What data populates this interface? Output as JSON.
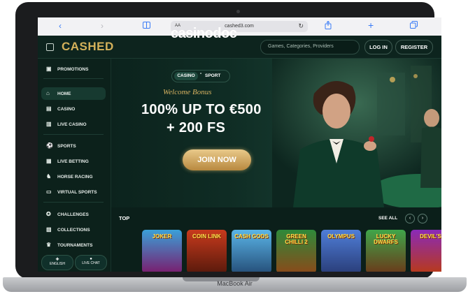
{
  "device": {
    "model": "MacBook Air"
  },
  "browser": {
    "text_size_label": "AA",
    "url": "cashed3.com",
    "back_icon": "chevron-left",
    "forward_icon": "chevron-right",
    "book_icon": "book",
    "share_icon": "share",
    "new_tab_icon": "plus",
    "tabs_icon": "tabs"
  },
  "watermark": {
    "text_pre": "casinod",
    "text_o": "o",
    "text_post": "c"
  },
  "header": {
    "logo": "CASHED",
    "search_placeholder": "Games, Categories, Providers",
    "login_label": "LOG IN",
    "register_label": "REGISTER"
  },
  "sidebar": {
    "items": [
      {
        "label": "PROMOTIONS",
        "icon": "gift"
      },
      {
        "label": "HOME",
        "icon": "home",
        "active": true
      },
      {
        "label": "CASINO",
        "icon": "cards"
      },
      {
        "label": "LIVE CASINO",
        "icon": "live-cards"
      },
      {
        "label": "SPORTS",
        "icon": "ball"
      },
      {
        "label": "LIVE BETTING",
        "icon": "live-bet"
      },
      {
        "label": "HORSE RACING",
        "icon": "horse"
      },
      {
        "label": "VIRTUAL SPORTS",
        "icon": "monitor"
      },
      {
        "label": "CHALLENGES",
        "icon": "medal"
      },
      {
        "label": "COLLECTIONS",
        "icon": "collection"
      },
      {
        "label": "TOURNAMENTS",
        "icon": "trophy"
      }
    ],
    "language": "ENGLISH",
    "live_chat": "LIVE CHAT"
  },
  "hero": {
    "tab_casino": "CASINO",
    "tab_sport": "SPORT",
    "welcome": "Welcome Bonus",
    "offer_line1": "100% UP TO €500",
    "offer_line2": "+ 200 FS",
    "cta": "JOIN NOW"
  },
  "games": {
    "title": "TOP",
    "see_all": "SEE ALL",
    "tiles": [
      {
        "name": "JOKER",
        "color_top": "#3aa0d8",
        "color_bottom": "#7a1d6e"
      },
      {
        "name": "COIN LINK",
        "color_top": "#c83a1d",
        "color_bottom": "#5a1a0c"
      },
      {
        "name": "CASH GODS",
        "color_top": "#5ab5e8",
        "color_bottom": "#26507a"
      },
      {
        "name": "GREEN CHILLI 2",
        "color_top": "#2e8a3a",
        "color_bottom": "#8a4a1a"
      },
      {
        "name": "OLYMPUS",
        "color_top": "#4f7ed8",
        "color_bottom": "#2a3e7a"
      },
      {
        "name": "LUCKY DWARFS",
        "color_top": "#3fa64a",
        "color_bottom": "#6a3a1a"
      },
      {
        "name": "DEVIL'S",
        "color_top": "#8a2ab8",
        "color_bottom": "#b83a1a"
      }
    ]
  },
  "colors": {
    "accent_gold": "#d4b15a",
    "background": "#0b1f1a",
    "active_nav": "#173a30"
  }
}
